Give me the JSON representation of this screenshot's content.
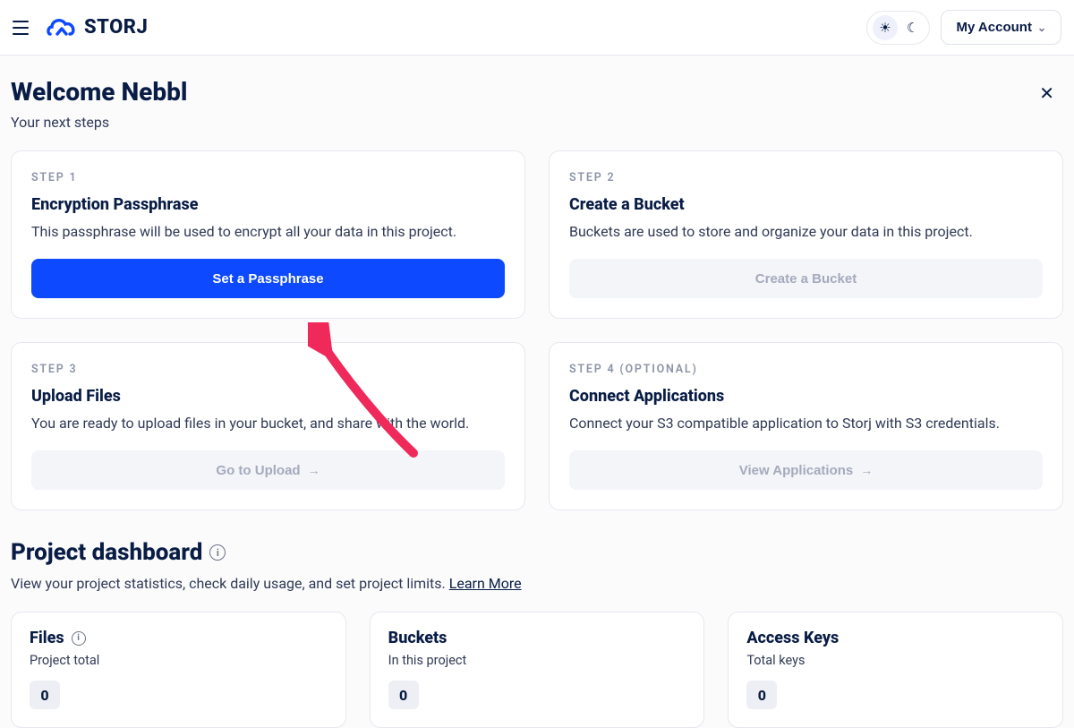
{
  "brand": {
    "name": "STORJ"
  },
  "header": {
    "account_label": "My Account"
  },
  "welcome": {
    "title": "Welcome Nebbl",
    "subtitle": "Your next steps"
  },
  "steps": [
    {
      "label": "STEP 1",
      "title": "Encryption Passphrase",
      "desc": "This passphrase will be used to encrypt all your data in this project.",
      "button": "Set a Passphrase",
      "primary": true
    },
    {
      "label": "STEP 2",
      "title": "Create a Bucket",
      "desc": "Buckets are used to store and organize your data in this project.",
      "button": "Create a Bucket",
      "primary": false
    },
    {
      "label": "STEP 3",
      "title": "Upload Files",
      "desc": "You are ready to upload files in your bucket, and share with the world.",
      "button": "Go to Upload",
      "primary": false,
      "arrow": true
    },
    {
      "label": "STEP 4 (OPTIONAL)",
      "title": "Connect Applications",
      "desc": "Connect your S3 compatible application to Storj with S3 credentials.",
      "button": "View Applications",
      "primary": false,
      "arrow": true
    }
  ],
  "dashboard": {
    "title": "Project dashboard",
    "subtitle_prefix": "View your project statistics, check daily usage, and set project limits. ",
    "learn_more": "Learn More"
  },
  "stats": [
    {
      "title": "Files",
      "sub": "Project total",
      "value": "0",
      "info": true
    },
    {
      "title": "Buckets",
      "sub": "In this project",
      "value": "0",
      "info": false
    },
    {
      "title": "Access Keys",
      "sub": "Total keys",
      "value": "0",
      "info": false
    }
  ]
}
